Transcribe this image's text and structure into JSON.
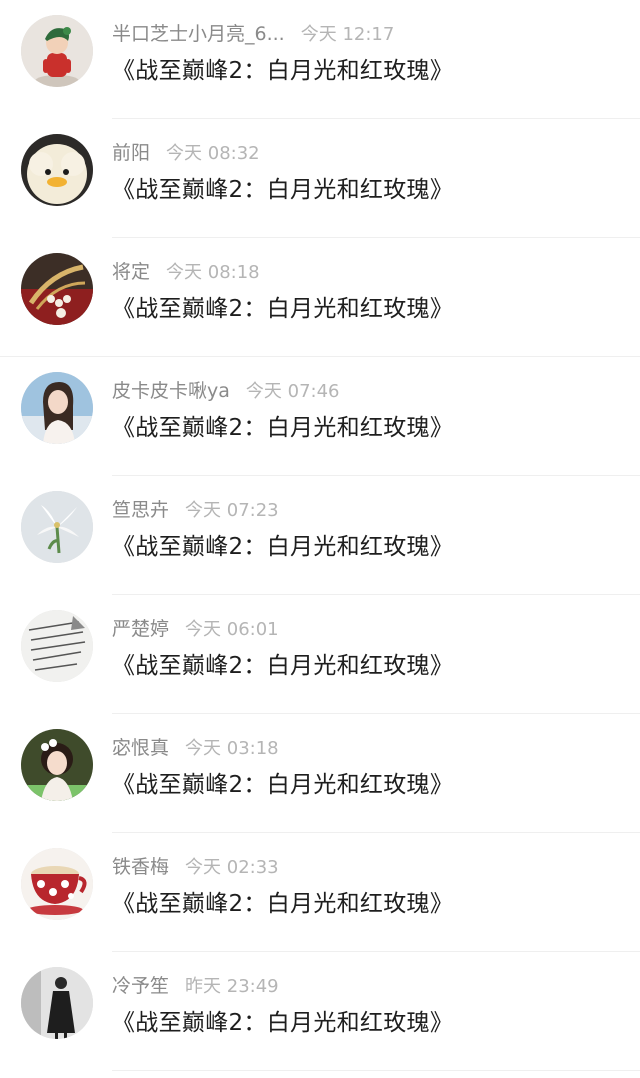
{
  "comments": [
    {
      "username": "半口芝士小月亮_6...",
      "time": "今天 12:17",
      "message": "《战至巅峰2：白月光和红玫瑰》",
      "avatar_icon": "doll-figure-avatar"
    },
    {
      "username": "前阳",
      "time": "今天 08:32",
      "message": "《战至巅峰2：白月光和红玫瑰》",
      "avatar_icon": "fluffy-duck-avatar"
    },
    {
      "username": "将定",
      "time": "今天 08:18",
      "message": "《战至巅峰2：白月光和红玫瑰》",
      "avatar_icon": "pearl-brooch-avatar"
    },
    {
      "username": "皮卡皮卡啾ya",
      "time": "今天 07:46",
      "message": "《战至巅峰2：白月光和红玫瑰》",
      "avatar_icon": "girl-portrait-avatar"
    },
    {
      "username": "笪思卉",
      "time": "今天 07:23",
      "message": "《战至巅峰2：白月光和红玫瑰》",
      "avatar_icon": "white-lily-avatar"
    },
    {
      "username": "严楚婷",
      "time": "今天 06:01",
      "message": "《战至巅峰2：白月光和红玫瑰》",
      "avatar_icon": "handwritten-text-avatar"
    },
    {
      "username": "宓恨真",
      "time": "今天 03:18",
      "message": "《战至巅峰2：白月光和红玫瑰》",
      "avatar_icon": "girl-with-flowers-avatar"
    },
    {
      "username": "铁香梅",
      "time": "今天 02:33",
      "message": "《战至巅峰2：白月光和红玫瑰》",
      "avatar_icon": "polka-dot-teacup-avatar"
    },
    {
      "username": "冷予笙",
      "time": "昨天 23:49",
      "message": "《战至巅峰2：白月光和红玫瑰》",
      "avatar_icon": "dark-dress-figure-avatar"
    }
  ]
}
